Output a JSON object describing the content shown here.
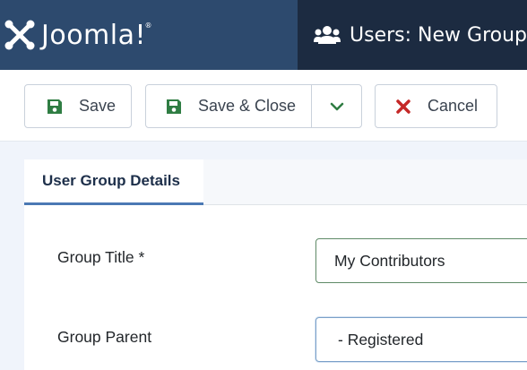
{
  "header": {
    "brand": "Joomla!",
    "page_title": "Users: New Group"
  },
  "toolbar": {
    "save_label": "Save",
    "save_close_label": "Save & Close",
    "cancel_label": "Cancel"
  },
  "tabs": [
    {
      "label": "User Group Details",
      "active": true
    }
  ],
  "form": {
    "group_title_label": "Group Title *",
    "group_title_value": "My Contributors",
    "group_parent_label": "Group Parent",
    "group_parent_value": "- Registered"
  },
  "colors": {
    "brand_bg": "#2d4a6e",
    "title_bg": "#1c2b41",
    "save_icon": "#2f7d43",
    "cancel_icon": "#c52827",
    "tab_accent": "#4b79b4"
  },
  "icons": {
    "brand": "joomla-logo-icon",
    "page": "users-icon",
    "save": "save-icon",
    "dropdown": "chevron-down-icon",
    "cancel": "close-icon"
  }
}
